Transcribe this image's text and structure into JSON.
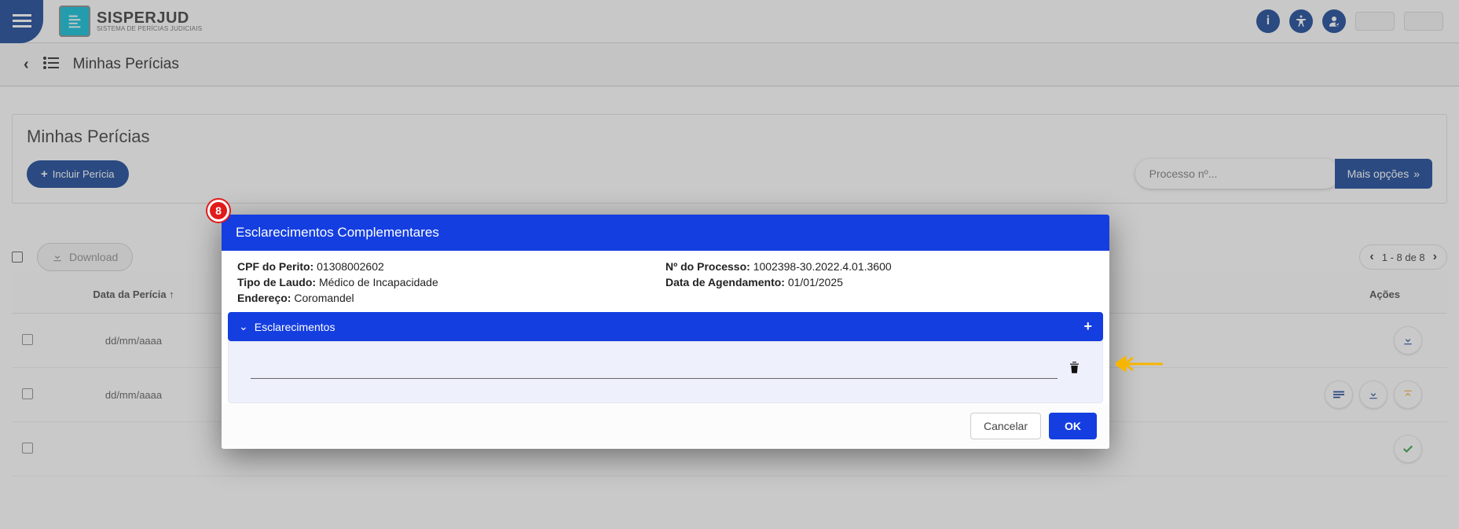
{
  "brand": {
    "name": "SISPERJUD",
    "subtitle": "SISTEMA DE PERÍCIAS JUDICIAIS"
  },
  "subbar": {
    "title": "Minhas Perícias"
  },
  "card": {
    "title": "Minhas Perícias",
    "include_btn": "Incluir Perícia",
    "search_placeholder": "Processo nº...",
    "more_options": "Mais opções"
  },
  "toolbar": {
    "download": "Download",
    "pager": "1 - 8 de 8"
  },
  "table": {
    "headers": {
      "date": "Data da Perícia",
      "sort_arrow": "↑",
      "actions": "Ações"
    },
    "rows": [
      {
        "date": "dd/mm/aaaa"
      },
      {
        "date": "dd/mm/aaaa"
      },
      {
        "date": ""
      }
    ]
  },
  "modal": {
    "title": "Esclarecimentos Complementares",
    "fields": {
      "cpf_label": "CPF do Perito:",
      "cpf_value": "01308002602",
      "tipo_label": "Tipo de Laudo:",
      "tipo_value": "Médico de Incapacidade",
      "end_label": "Endereço:",
      "end_value": "Coromandel",
      "proc_label": "Nº do Processo:",
      "proc_value": "1002398-30.2022.4.01.3600",
      "data_label": "Data de Agendamento:",
      "data_value": "01/01/2025"
    },
    "section_title": "Esclarecimentos",
    "cancel": "Cancelar",
    "ok": "OK"
  },
  "annotations": {
    "step_number": "8"
  }
}
